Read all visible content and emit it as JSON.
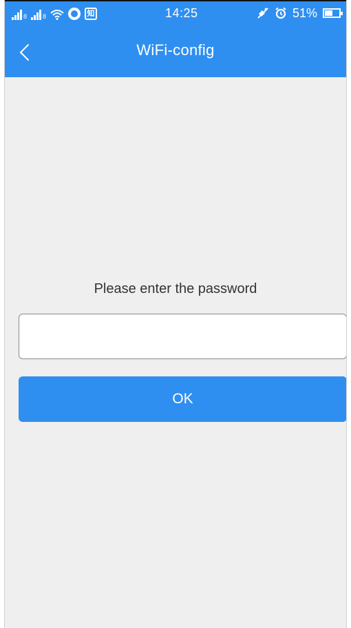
{
  "status_bar": {
    "time": "14:25",
    "battery_percent": "51%",
    "battery_level": 0.51,
    "app_icon_label": "知"
  },
  "app_bar": {
    "title": "WiFi-config"
  },
  "form": {
    "prompt": "Please enter the password",
    "password_value": "",
    "password_placeholder": "",
    "ok_label": "OK"
  },
  "colors": {
    "accent": "#2f8ff0",
    "background": "#efefef",
    "text": "#333333"
  }
}
